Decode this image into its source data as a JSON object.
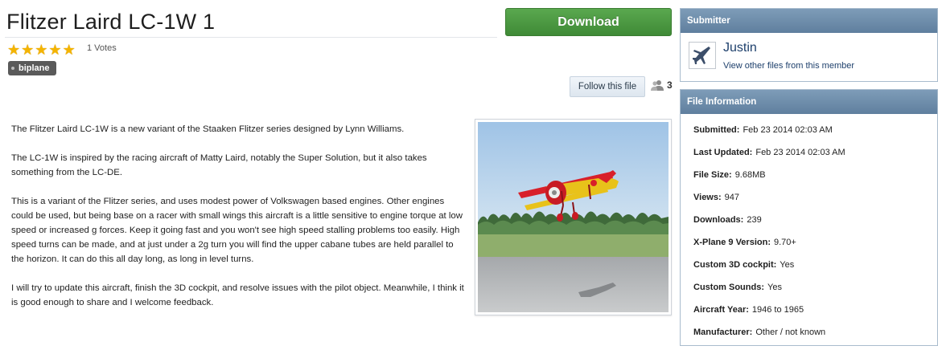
{
  "file": {
    "title": "Flitzer Laird LC-1W 1",
    "rating_stars": 5,
    "votes": "1 Votes",
    "tag": "biplane"
  },
  "actions": {
    "download_label": "Download",
    "follow_label": "Follow this file",
    "followers_count": "3"
  },
  "description": {
    "paragraphs": [
      "The Flitzer Laird LC-1W is a new variant of the Staaken Flitzer series designed by Lynn Williams.",
      "The LC-1W is inspired by the racing aircraft of Matty Laird, notably the Super Solution, but it also takes something from the LC-DE.",
      "This is a variant of the Flitzer series, and uses modest power of Volkswagen based engines. Other engines could be used, but being base on a racer with small wings this aircraft is a little sensitive to engine torque at low speed or increased g forces. Keep it going fast and you won't see high speed stalling problems too easily. High speed turns can be made, and at just under a 2g turn you will find the upper cabane tubes are held parallel to the horizon. It can do this all day long, as long in level turns.",
      "I will try to update this aircraft, finish the 3D cockpit, and resolve issues with the pilot object. Meanwhile, I think it is good enough to share and I welcome feedback."
    ]
  },
  "submitter": {
    "heading": "Submitter",
    "name": "Justin",
    "other_files_link": "View other files from this member"
  },
  "file_info": {
    "heading": "File Information",
    "rows": [
      {
        "label": "Submitted:",
        "value": "Feb 23 2014 02:03 AM"
      },
      {
        "label": "Last Updated:",
        "value": "Feb 23 2014 02:03 AM"
      },
      {
        "label": "File Size:",
        "value": "9.68MB"
      },
      {
        "label": "Views:",
        "value": "947"
      },
      {
        "label": "Downloads:",
        "value": "239"
      },
      {
        "label": "X-Plane 9 Version:",
        "value": "9.70+"
      },
      {
        "label": "Custom 3D cockpit:",
        "value": "Yes"
      },
      {
        "label": "Custom Sounds:",
        "value": "Yes"
      },
      {
        "label": "Aircraft Year:",
        "value": "1946 to 1965"
      },
      {
        "label": "Manufacturer:",
        "value": "Other / not known"
      }
    ]
  },
  "colors": {
    "download_green": "#4a9a42",
    "panel_header": "#6f8dab",
    "link_blue": "#1d3f6b",
    "star_gold": "#f4b400"
  }
}
